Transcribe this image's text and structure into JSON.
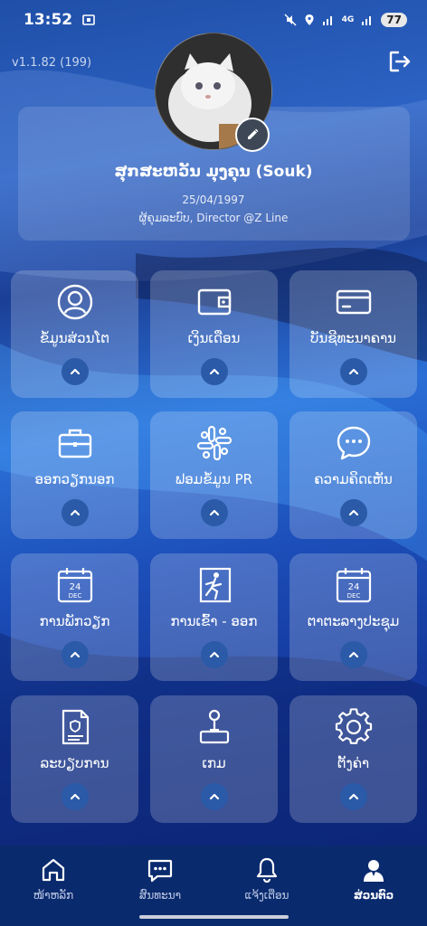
{
  "status_bar": {
    "time": "13:52",
    "network": "4G",
    "battery": "77"
  },
  "app": {
    "version": "v1.1.82 (199)"
  },
  "profile": {
    "name": "ສຸກສະຫວັນ ມຸງຄຸນ (Souk)",
    "dob": "25/04/1997",
    "role": "ຜູ້ຄຸມລະບົບ, Director @Z Line"
  },
  "tiles": [
    {
      "label": "ຂໍ້ມູນສ່ວນໂຕ",
      "icon": "user-circle-icon"
    },
    {
      "label": "ເງິນເດືອນ",
      "icon": "wallet-icon"
    },
    {
      "label": "ບັນຊີທະນາຄານ",
      "icon": "credit-card-icon"
    },
    {
      "label": "ອອກວຽກນອກ",
      "icon": "briefcase-icon"
    },
    {
      "label": "ຟອມຂໍ້ມູນ PR",
      "icon": "slack-icon"
    },
    {
      "label": "ຄວາມຄິດເຫັນ",
      "icon": "chat-bubble-icon"
    },
    {
      "label": "ການພັກວຽກ",
      "icon": "calendar-icon",
      "badge": "24",
      "sub": "DEC"
    },
    {
      "label": "ການເຂົ້າ - ອອກ",
      "icon": "exit-door-icon"
    },
    {
      "label": "ຕາຕະລາງປະຊຸມ",
      "icon": "calendar-icon",
      "badge": "24",
      "sub": "DEC"
    },
    {
      "label": "ລະບຽບການ",
      "icon": "document-shield-icon"
    },
    {
      "label": "ເກມ",
      "icon": "joystick-icon"
    },
    {
      "label": "ຕັ້ງຄ່າ",
      "icon": "gear-icon"
    }
  ],
  "nav": [
    {
      "label": "ໜ້າຫລັກ",
      "icon": "home-icon",
      "active": false
    },
    {
      "label": "ສົນທະນາ",
      "icon": "chat-icon",
      "active": false
    },
    {
      "label": "ແຈ້ງເຕືອນ",
      "icon": "bell-icon",
      "active": false
    },
    {
      "label": "ສ່ວນຕົວ",
      "icon": "profile-icon",
      "active": true
    }
  ]
}
